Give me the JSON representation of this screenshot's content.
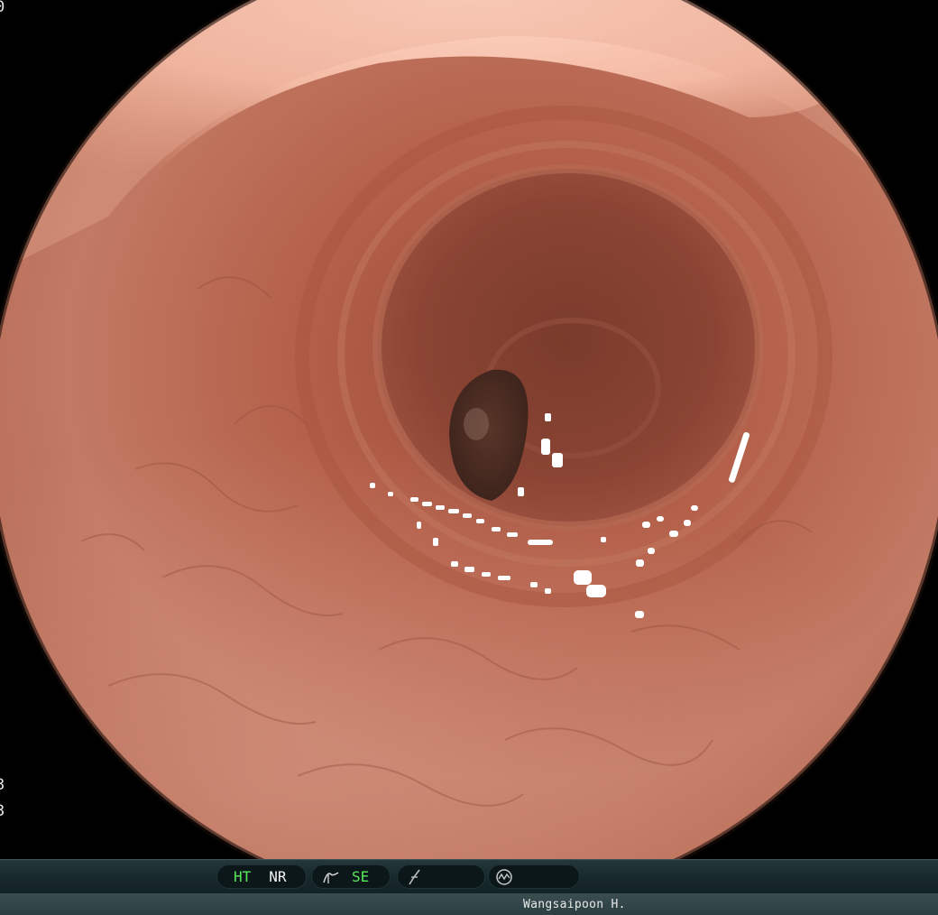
{
  "status_bar": {
    "ht_label": "HT",
    "nr_label": "NR",
    "se_label": "SE",
    "ht_color": "#58e85a",
    "se_color": "#58e85a",
    "icons": [
      "structure-enhancement-icon",
      "color-mode-icon",
      "light-source-icon"
    ]
  },
  "footer": {
    "operator_name": "Wangsaipoon H."
  },
  "edge_text": {
    "top": "0",
    "lower_1": "3",
    "lower_2": "3"
  }
}
